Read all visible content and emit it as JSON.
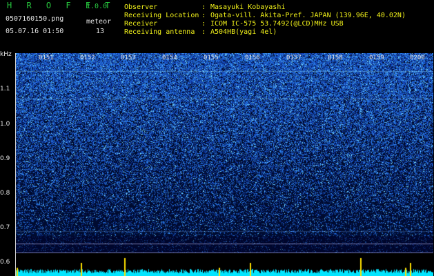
{
  "header": {
    "app_name": "H R O F F T",
    "version": "1.0.0",
    "file_name": "0507160150.png",
    "meteor_label": "meteor",
    "meteor_count": "13",
    "datetime": "05.07.16 01:50",
    "meta": [
      {
        "key": "Observer",
        "value": "Masayuki Kobayashi"
      },
      {
        "key": "Receiving Location",
        "value": "Ogata-vill. Akita-Pref. JAPAN (139.96E, 40.02N)"
      },
      {
        "key": "Receiver",
        "value": "ICOM IC-575 53.7492(@LCD)MHz USB"
      },
      {
        "key": "Receiving antenna",
        "value": "A504HB(yagi 4el)"
      }
    ],
    "colon": ":"
  },
  "axis": {
    "y_unit": "kHz",
    "y_ticks": [
      "1.1",
      "1.0",
      "0.9",
      "0.8",
      "0.7",
      "0.6"
    ],
    "x_ticks": [
      "0151",
      "0152",
      "0153",
      "0154",
      "0155",
      "0156",
      "0157",
      "0158",
      "0159",
      "0200"
    ]
  },
  "colors": {
    "background": "#000000",
    "waterfall_base": "#000a3a",
    "waterfall_noise": "#2a56ff",
    "level_trace": "#00e5ff",
    "meteor_marker": "#ffe000",
    "header_green": "#27c93f",
    "header_yellow": "#f2f21a"
  }
}
